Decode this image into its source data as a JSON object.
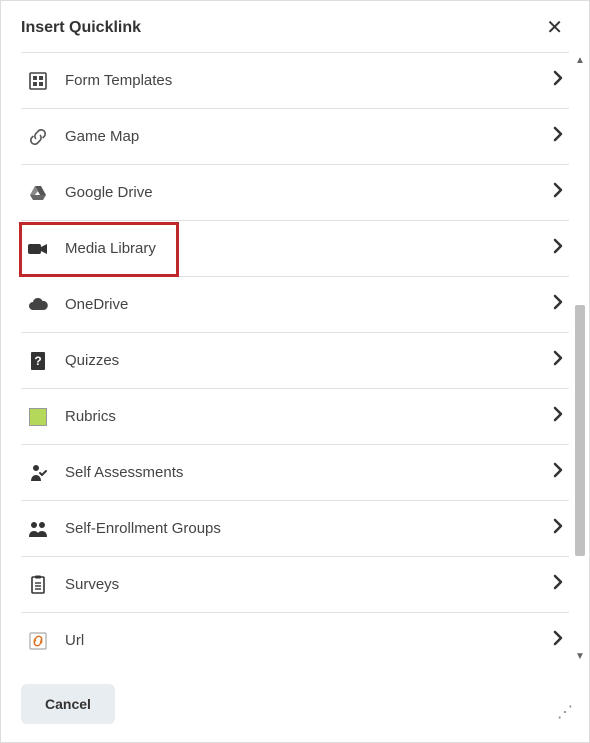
{
  "header": {
    "title": "Insert Quicklink"
  },
  "items": [
    {
      "label": "Form Templates",
      "icon": "form-templates-icon"
    },
    {
      "label": "Game Map",
      "icon": "link-icon"
    },
    {
      "label": "Google Drive",
      "icon": "google-drive-icon"
    },
    {
      "label": "Media Library",
      "icon": "video-camera-icon",
      "highlighted": true
    },
    {
      "label": "OneDrive",
      "icon": "cloud-icon"
    },
    {
      "label": "Quizzes",
      "icon": "quiz-icon"
    },
    {
      "label": "Rubrics",
      "icon": "rubrics-icon"
    },
    {
      "label": "Self Assessments",
      "icon": "person-check-icon"
    },
    {
      "label": "Self-Enrollment Groups",
      "icon": "group-icon"
    },
    {
      "label": "Surveys",
      "icon": "clipboard-icon"
    },
    {
      "label": "Url",
      "icon": "url-icon"
    }
  ],
  "footer": {
    "cancel_label": "Cancel"
  }
}
